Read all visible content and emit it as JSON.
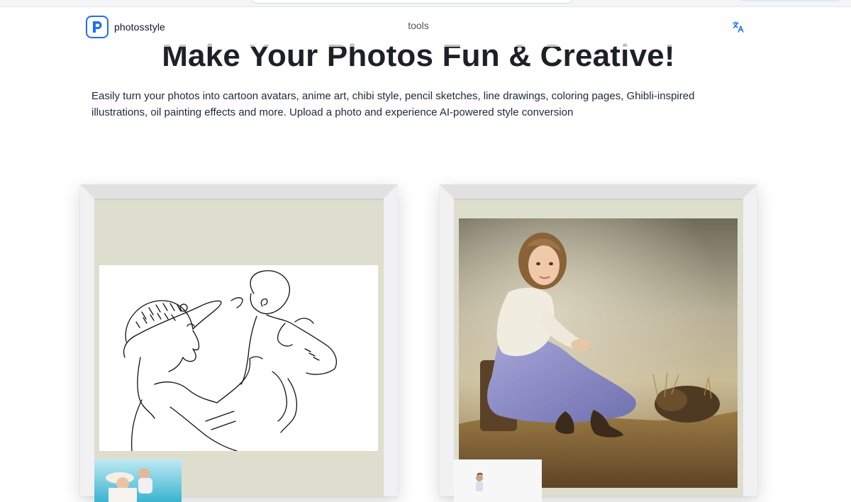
{
  "header": {
    "brand_name": "photosstyle",
    "nav_tools": "tools",
    "logo_icon": "p-logo-icon",
    "language_icon": "translate-icon",
    "accent_color": "#1e6ff2"
  },
  "hero": {
    "title": "Make Your Photos Fun & Creative!",
    "description": "Easily turn your photos into cartoon avatars, anime art, chibi style, pencil sketches, line drawings, coloring pages, Ghibli-inspired illustrations, oil painting effects and more. Upload a photo and experience AI-powered style conversion"
  },
  "gallery": {
    "frames": [
      {
        "artwork": "line-drawing of a woman in a sun hat lifting a baby",
        "thumbnail": "original beach photo"
      },
      {
        "artwork": "oil painting of a girl in a lavender dress sitting on a stump",
        "thumbnail": "original photo"
      }
    ]
  }
}
